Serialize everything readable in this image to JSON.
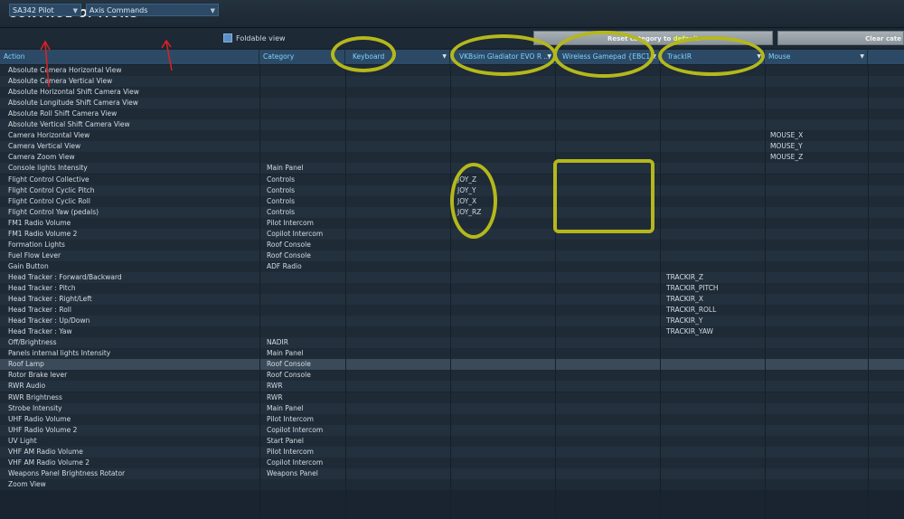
{
  "window": {
    "title": "CONTROL OPTIONS"
  },
  "toolbar": {
    "aircraft_select": "SA342 Pilot",
    "category_select": "Axis Commands",
    "foldable_label": "Foldable view",
    "reset_button": {
      "prefix": "Reset category to ",
      "highlight": "default"
    },
    "clear_button": "Clear cate"
  },
  "columns": [
    {
      "key": "action",
      "label": "Action"
    },
    {
      "key": "category",
      "label": "Category"
    },
    {
      "key": "keyboard",
      "label": "Keyboard"
    },
    {
      "key": "vkb",
      "label": "VKBsim Gladiator EVO  R ..."
    },
    {
      "key": "gamepad",
      "label": "Wireless Gamepad {EBC1..."
    },
    {
      "key": "trackir",
      "label": "TrackIR"
    },
    {
      "key": "mouse",
      "label": "Mouse"
    }
  ],
  "rows": [
    {
      "action": "Absolute Camera Horizontal View",
      "category": "",
      "vkb": "",
      "trackir": "",
      "mouse": ""
    },
    {
      "action": "Absolute Camera Vertical View",
      "category": "",
      "vkb": "",
      "trackir": "",
      "mouse": ""
    },
    {
      "action": "Absolute Horizontal Shift Camera View",
      "category": "",
      "vkb": "",
      "trackir": "",
      "mouse": ""
    },
    {
      "action": "Absolute Longitude Shift Camera View",
      "category": "",
      "vkb": "",
      "trackir": "",
      "mouse": ""
    },
    {
      "action": "Absolute Roll Shift Camera View",
      "category": "",
      "vkb": "",
      "trackir": "",
      "mouse": ""
    },
    {
      "action": "Absolute Vertical Shift Camera View",
      "category": "",
      "vkb": "",
      "trackir": "",
      "mouse": ""
    },
    {
      "action": "Camera Horizontal View",
      "category": "",
      "vkb": "",
      "trackir": "",
      "mouse": "MOUSE_X"
    },
    {
      "action": "Camera Vertical View",
      "category": "",
      "vkb": "",
      "trackir": "",
      "mouse": "MOUSE_Y"
    },
    {
      "action": "Camera Zoom View",
      "category": "",
      "vkb": "",
      "trackir": "",
      "mouse": "MOUSE_Z"
    },
    {
      "action": "Console lights Intensity",
      "category": "Main Panel",
      "vkb": "",
      "trackir": "",
      "mouse": ""
    },
    {
      "action": "Flight Control Collective",
      "category": "Controls",
      "vkb": "JOY_Z",
      "trackir": "",
      "mouse": ""
    },
    {
      "action": "Flight Control Cyclic Pitch",
      "category": "Controls",
      "vkb": "JOY_Y",
      "trackir": "",
      "mouse": ""
    },
    {
      "action": "Flight Control Cyclic Roll",
      "category": "Controls",
      "vkb": "JOY_X",
      "trackir": "",
      "mouse": ""
    },
    {
      "action": "Flight Control Yaw (pedals)",
      "category": "Controls",
      "vkb": "JOY_RZ",
      "trackir": "",
      "mouse": ""
    },
    {
      "action": "FM1 Radio Volume",
      "category": "Pilot Intercom",
      "vkb": "",
      "trackir": "",
      "mouse": ""
    },
    {
      "action": "FM1 Radio Volume 2",
      "category": "Copilot Intercom",
      "vkb": "",
      "trackir": "",
      "mouse": ""
    },
    {
      "action": "Formation Lights",
      "category": "Roof Console",
      "vkb": "",
      "trackir": "",
      "mouse": ""
    },
    {
      "action": "Fuel Flow Lever",
      "category": "Roof Console",
      "vkb": "",
      "trackir": "",
      "mouse": ""
    },
    {
      "action": "Gain Button",
      "category": "ADF Radio",
      "vkb": "",
      "trackir": "",
      "mouse": ""
    },
    {
      "action": "Head Tracker : Forward/Backward",
      "category": "",
      "vkb": "",
      "trackir": "TRACKIR_Z",
      "mouse": ""
    },
    {
      "action": "Head Tracker : Pitch",
      "category": "",
      "vkb": "",
      "trackir": "TRACKIR_PITCH",
      "mouse": ""
    },
    {
      "action": "Head Tracker : Right/Left",
      "category": "",
      "vkb": "",
      "trackir": "TRACKIR_X",
      "mouse": ""
    },
    {
      "action": "Head Tracker : Roll",
      "category": "",
      "vkb": "",
      "trackir": "TRACKIR_ROLL",
      "mouse": ""
    },
    {
      "action": "Head Tracker : Up/Down",
      "category": "",
      "vkb": "",
      "trackir": "TRACKIR_Y",
      "mouse": ""
    },
    {
      "action": "Head Tracker : Yaw",
      "category": "",
      "vkb": "",
      "trackir": "TRACKIR_YAW",
      "mouse": ""
    },
    {
      "action": "Off/Brightness",
      "category": "NADIR",
      "vkb": "",
      "trackir": "",
      "mouse": ""
    },
    {
      "action": "Panels internal lights Intensity",
      "category": "Main Panel",
      "vkb": "",
      "trackir": "",
      "mouse": ""
    },
    {
      "action": "Roof Lamp",
      "category": "Roof Console",
      "vkb": "",
      "trackir": "",
      "mouse": "",
      "selected": true
    },
    {
      "action": "Rotor Brake lever",
      "category": "Roof Console",
      "vkb": "",
      "trackir": "",
      "mouse": ""
    },
    {
      "action": "RWR Audio",
      "category": "RWR",
      "vkb": "",
      "trackir": "",
      "mouse": ""
    },
    {
      "action": "RWR Brightness",
      "category": "RWR",
      "vkb": "",
      "trackir": "",
      "mouse": ""
    },
    {
      "action": "Strobe Intensity",
      "category": "Main Panel",
      "vkb": "",
      "trackir": "",
      "mouse": ""
    },
    {
      "action": "UHF Radio Volume",
      "category": "Pilot Intercom",
      "vkb": "",
      "trackir": "",
      "mouse": ""
    },
    {
      "action": "UHF Radio Volume 2",
      "category": "Copilot Intercom",
      "vkb": "",
      "trackir": "",
      "mouse": ""
    },
    {
      "action": "UV Light",
      "category": "Start Panel",
      "vkb": "",
      "trackir": "",
      "mouse": ""
    },
    {
      "action": "VHF AM Radio Volume",
      "category": "Pilot Intercom",
      "vkb": "",
      "trackir": "",
      "mouse": ""
    },
    {
      "action": "VHF AM Radio Volume 2",
      "category": "Copilot Intercom",
      "vkb": "",
      "trackir": "",
      "mouse": ""
    },
    {
      "action": "Weapons Panel Brightness Rotator",
      "category": "Weapons Panel",
      "vkb": "",
      "trackir": "",
      "mouse": ""
    },
    {
      "action": "Zoom View",
      "category": "",
      "vkb": "",
      "trackir": "",
      "mouse": ""
    }
  ],
  "colors": {
    "header_bg": "#2c4a66",
    "header_text": "#7fd3ff",
    "annotation": "#b5b81a",
    "arrow": "#e02020"
  }
}
